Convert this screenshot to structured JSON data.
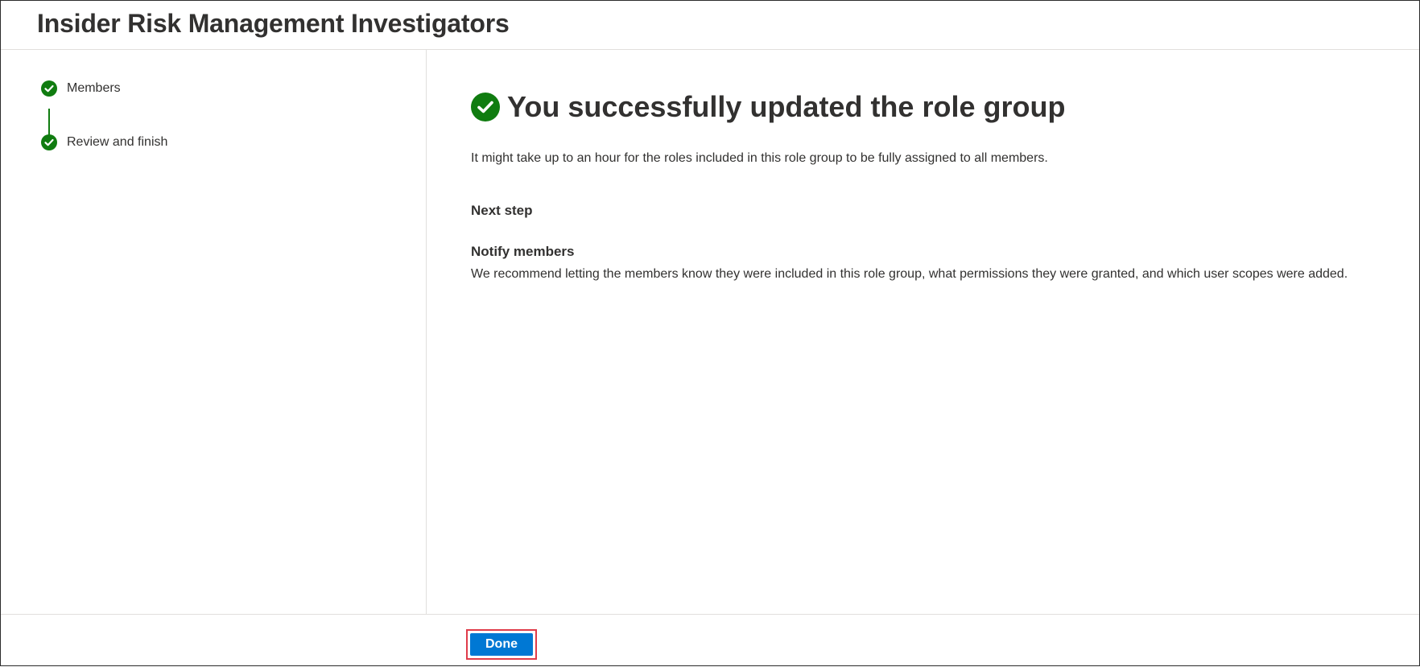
{
  "header": {
    "title": "Insider Risk Management Investigators"
  },
  "steps": [
    {
      "label": "Members",
      "status": "completed",
      "icon": "checkmark-circle-icon"
    },
    {
      "label": "Review and finish",
      "status": "completed",
      "icon": "checkmark-circle-icon"
    }
  ],
  "main": {
    "success_title": "You successfully updated the role group",
    "success_icon": "checkmark-circle-icon",
    "description": "It might take up to an hour for the roles included in this role group to be fully assigned to all members.",
    "next_step_heading": "Next step",
    "notify_title": "Notify members",
    "notify_body": "We recommend letting the members know they were included in this role group, what permissions they were granted, and which user scopes were added."
  },
  "footer": {
    "done_label": "Done"
  },
  "colors": {
    "success_green": "#107c10",
    "primary_blue": "#0078d4",
    "highlight_red": "#e03c4a",
    "text": "#323130",
    "divider": "#e1dfdd"
  }
}
